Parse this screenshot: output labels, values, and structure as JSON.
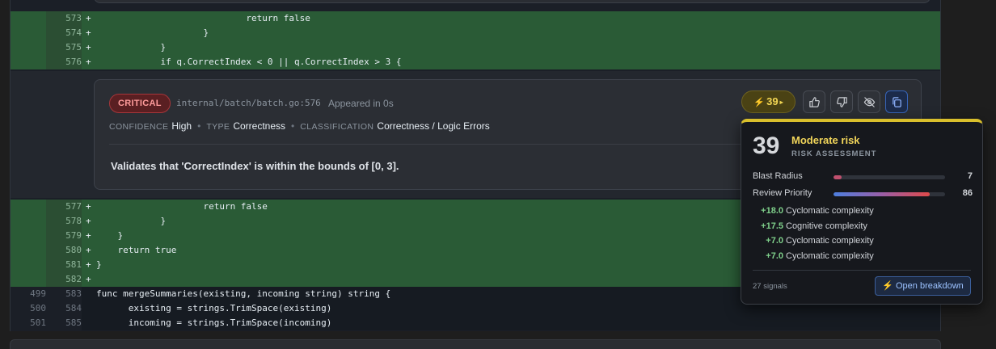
{
  "diff": {
    "rows_top": [
      {
        "old": "",
        "new": "573",
        "sign": "+",
        "code": "                            return false",
        "type": "add"
      },
      {
        "old": "",
        "new": "574",
        "sign": "+",
        "code": "                    }",
        "type": "add"
      },
      {
        "old": "",
        "new": "575",
        "sign": "+",
        "code": "            }",
        "type": "add"
      },
      {
        "old": "",
        "new": "576",
        "sign": "+",
        "code": "            if q.CorrectIndex < 0 || q.CorrectIndex > 3 {",
        "type": "add"
      }
    ],
    "rows_bottom": [
      {
        "old": "",
        "new": "577",
        "sign": "+",
        "code": "                    return false",
        "type": "add"
      },
      {
        "old": "",
        "new": "578",
        "sign": "+",
        "code": "            }",
        "type": "add"
      },
      {
        "old": "",
        "new": "579",
        "sign": "+",
        "code": "    }",
        "type": "add"
      },
      {
        "old": "",
        "new": "580",
        "sign": "+",
        "code": "    return true",
        "type": "add"
      },
      {
        "old": "",
        "new": "581",
        "sign": "+",
        "code": "}",
        "type": "add"
      },
      {
        "old": "",
        "new": "582",
        "sign": "+",
        "code": "",
        "type": "add"
      },
      {
        "old": "499",
        "new": "583",
        "sign": "",
        "code": "func mergeSummaries(existing, incoming string) string {",
        "type": "ctx"
      },
      {
        "old": "500",
        "new": "584",
        "sign": "",
        "code": "      existing = strings.TrimSpace(existing)",
        "type": "ctx"
      },
      {
        "old": "501",
        "new": "585",
        "sign": "",
        "code": "      incoming = strings.TrimSpace(incoming)",
        "type": "ctx"
      }
    ]
  },
  "comment": {
    "severity": "CRITICAL",
    "file_path": "internal/batch/batch.go:576",
    "appeared": "Appeared in 0s",
    "confidence_key": "CONFIDENCE",
    "confidence_val": "High",
    "type_key": "TYPE",
    "type_val": "Correctness",
    "classification_key": "CLASSIFICATION",
    "classification_val": "Correctness / Logic Errors",
    "body": "Validates that 'CorrectIndex' is within the bounds of [0, 3].",
    "score": "39",
    "actions": [
      "thumbs-up-icon",
      "thumbs-down-icon",
      "eye-off-icon",
      "copy-icon"
    ]
  },
  "risk": {
    "score": "39",
    "level": "Moderate risk",
    "subtitle": "RISK ASSESSMENT",
    "metrics": [
      {
        "label": "Blast Radius",
        "value": "7",
        "fraction": 0.07,
        "color": "#c0506e"
      },
      {
        "label": "Review Priority",
        "value": "86",
        "fraction": 0.86,
        "color": "#e04a4a"
      }
    ],
    "signals": [
      {
        "delta": "+18.0",
        "name": "Cyclomatic complexity"
      },
      {
        "delta": "+17.5",
        "name": "Cognitive complexity"
      },
      {
        "delta": "+7.0",
        "name": "Cyclomatic complexity"
      },
      {
        "delta": "+7.0",
        "name": "Cyclomatic complexity"
      }
    ],
    "signal_count": "27 signals",
    "breakdown_label": "Open breakdown"
  },
  "colors": {
    "accent_gold": "#f1d55a",
    "critical_red": "#ff9c9c",
    "added_line_bg": "#2a5b36",
    "link_blue": "#9cc2ff"
  }
}
